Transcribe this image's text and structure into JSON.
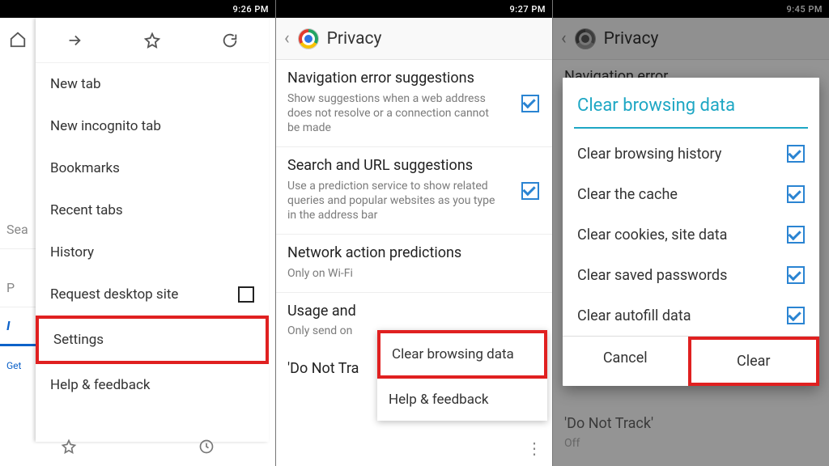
{
  "panel1": {
    "status_time": "9:26 PM",
    "menu": {
      "items": [
        {
          "label": "New tab"
        },
        {
          "label": "New incognito tab"
        },
        {
          "label": "Bookmarks"
        },
        {
          "label": "Recent tabs"
        },
        {
          "label": "History"
        },
        {
          "label": "Request desktop site",
          "checkbox": true
        },
        {
          "label": "Settings",
          "highlight": true
        },
        {
          "label": "Help & feedback"
        }
      ]
    },
    "under": {
      "search": "Sea",
      "p_row": "P",
      "b_row": "I",
      "get": "Get"
    }
  },
  "panel2": {
    "status_time": "9:27 PM",
    "header": "Privacy",
    "prefs": [
      {
        "title": "Navigation error suggestions",
        "sub": "Show suggestions when a web address does not resolve or a connection cannot be made",
        "checked": true
      },
      {
        "title": "Search and URL suggestions",
        "sub": "Use a prediction service to show related queries and popular websites as you type in the address bar",
        "checked": true
      },
      {
        "title": "Network action predictions",
        "sub": "Only on Wi-Fi"
      },
      {
        "title": "Usage and ",
        "sub": "Only send on "
      },
      {
        "title": "'Do Not Tra",
        "sub": ""
      }
    ],
    "popup": [
      {
        "label": "Clear browsing data",
        "highlight": true
      },
      {
        "label": "Help & feedback"
      }
    ]
  },
  "panel3": {
    "status_time": "9:45 PM",
    "header": "Privacy",
    "under_title": "Navigation error",
    "dialog": {
      "title": "Clear browsing data",
      "options": [
        {
          "label": "Clear browsing history"
        },
        {
          "label": "Clear the cache"
        },
        {
          "label": "Clear cookies, site data"
        },
        {
          "label": "Clear saved passwords"
        },
        {
          "label": "Clear autofill data"
        }
      ],
      "cancel": "Cancel",
      "clear": "Clear"
    },
    "below": {
      "title": "'Do Not Track'",
      "sub": "Off"
    }
  }
}
